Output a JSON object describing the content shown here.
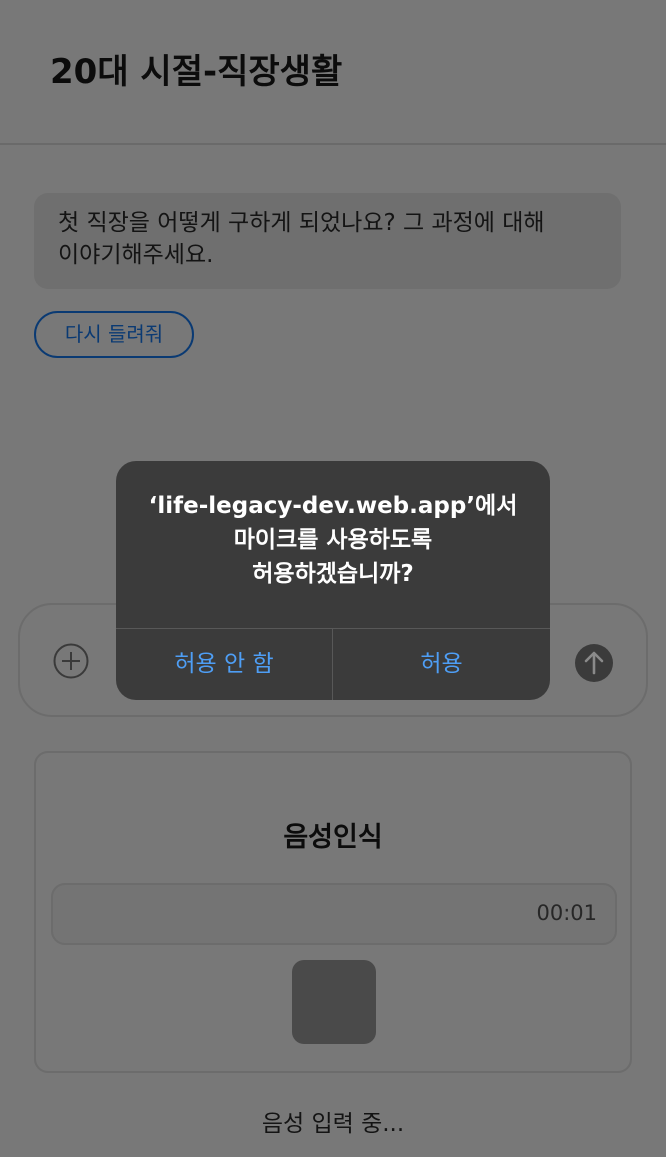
{
  "header": {
    "title": "20대 시절-직장생활"
  },
  "question": {
    "line1": "첫 직장을 어떻게 구하게 되었나요? 그 과정에 대해",
    "line2": "이야기해주세요."
  },
  "replay_button": {
    "label": "다시 들려줘"
  },
  "input_bar": {
    "plus_icon": "plus-circle-icon",
    "send_icon": "arrow-up-circle-icon"
  },
  "voice_panel": {
    "title": "음성인식",
    "timer": "00:01"
  },
  "status": {
    "text": "음성 입력 중..."
  },
  "permission_dialog": {
    "line1": "‘life-legacy-dev.web.app’에서",
    "line2": "마이크를 사용하도록",
    "line3": "허용하겠습니까?",
    "deny_label": "허용 안 함",
    "allow_label": "허용"
  },
  "colors": {
    "overlay_background": "#787878",
    "dialog_background": "#3b3b3b",
    "dialog_button_text": "#4e9ef5",
    "replay_button_border": "#0a3a73"
  }
}
